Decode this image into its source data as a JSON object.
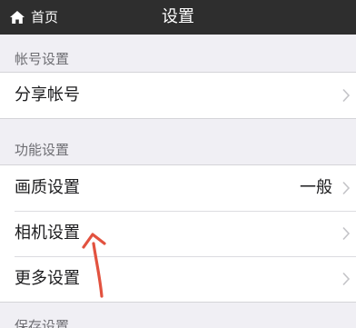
{
  "navbar": {
    "back_label": "首页",
    "title": "设置",
    "back_icon": "home-icon"
  },
  "sections": {
    "account": {
      "header": "帐号设置",
      "items": [
        {
          "label": "分享帐号",
          "value": ""
        }
      ]
    },
    "function": {
      "header": "功能设置",
      "items": [
        {
          "label": "画质设置",
          "value": "一般"
        },
        {
          "label": "相机设置",
          "value": ""
        },
        {
          "label": "更多设置",
          "value": ""
        }
      ]
    },
    "next": {
      "header": "保存设置"
    }
  },
  "colors": {
    "navbar_bg": "#2e2e2e",
    "page_bg": "#f0eff4",
    "annotation_arrow": "#e2523f"
  },
  "icons": {
    "chevron": "chevron-right-icon",
    "arrow": "red-arrow-annotation"
  }
}
